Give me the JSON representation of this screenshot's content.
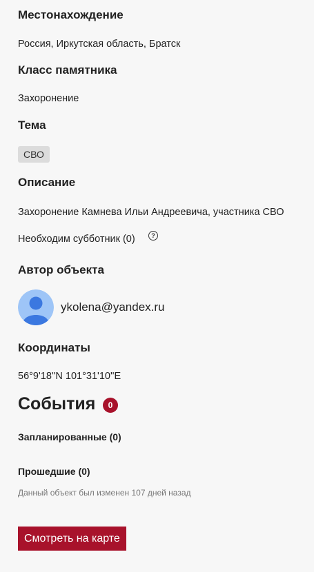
{
  "location": {
    "heading": "Местонахождение",
    "value": "Россия, Иркутская область, Братск"
  },
  "monument_class": {
    "heading": "Класс памятника",
    "value": "Захоронение"
  },
  "theme": {
    "heading": "Тема",
    "tag": "СВО"
  },
  "description": {
    "heading": "Описание",
    "text": "Захоронение Камнева Ильи Андреевича, участника СВО",
    "subbotnik": "Необходим субботник (0)",
    "help_icon": "?"
  },
  "author": {
    "heading": "Автор объекта",
    "email": "ykolena@yandex.ru"
  },
  "coordinates": {
    "heading": "Координаты",
    "value": "56°9'18''N 101°31'10''E"
  },
  "events": {
    "title": "События",
    "count": "0",
    "planned": "Запланированные (0)",
    "past": "Прошедшие (0)",
    "modified_note": "Данный объект был изменен 107 дней назад"
  },
  "actions": {
    "view_on_map": "Смотреть на карте"
  },
  "colors": {
    "accent": "#a8122b",
    "background": "#f7f7f7",
    "avatar_bg": "#9ec5f7",
    "avatar_fg": "#3b78e0"
  }
}
